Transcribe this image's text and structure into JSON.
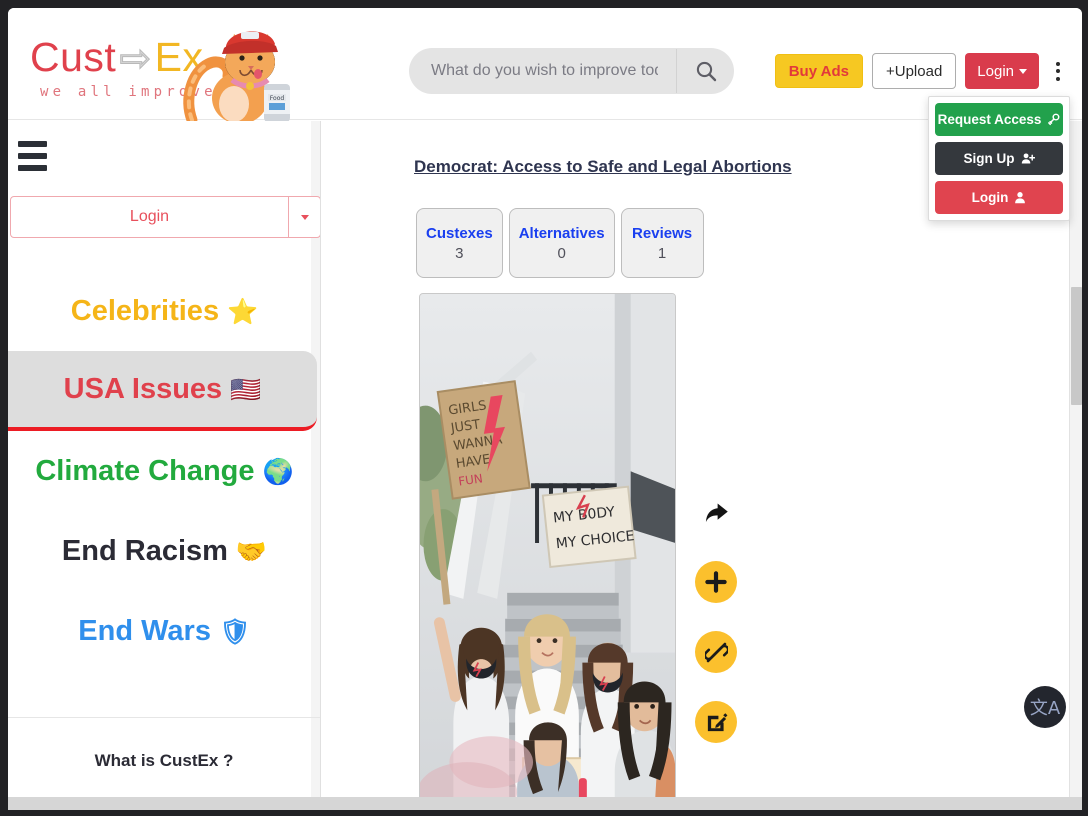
{
  "header": {
    "logo": {
      "word_cust": "Cust",
      "word_arrow": "⇨",
      "word_ex": "Ex",
      "tagline": "we all improve",
      "mascot_icon": "cat-mascot-icon"
    },
    "search": {
      "placeholder": "What do you wish to improve today?",
      "value": "",
      "icon": "search-icon"
    },
    "buy_ads_label": "Buy Ads",
    "upload_label": "+Upload",
    "login_label": "Login",
    "kebab_icon": "vertical-dots-icon"
  },
  "account_dropdown": {
    "items": [
      {
        "label": "Request Access",
        "icon": "key-icon",
        "color": "#22a14c"
      },
      {
        "label": "Sign Up",
        "icon": "user-plus-icon",
        "color": "#34383d"
      },
      {
        "label": "Login",
        "icon": "user-icon",
        "color": "#e0444f"
      }
    ]
  },
  "sidebar": {
    "hamburger_icon": "hamburger-menu-icon",
    "login_label": "Login",
    "login_caret_icon": "caret-down-icon",
    "nav_items": [
      {
        "label": "Celebrities",
        "emoji": "⭐",
        "icon": "star-icon",
        "color": "#f5b518",
        "active": false
      },
      {
        "label": "USA Issues",
        "emoji": "🇺🇸",
        "icon": "usa-flag-icon",
        "color": "#e0414c",
        "active": true
      },
      {
        "label": "Climate Change",
        "emoji": "🌍",
        "icon": "globe-icon",
        "color": "#22aa3e",
        "active": false
      },
      {
        "label": "End Racism",
        "emoji": "🤝",
        "icon": "handshake-icon",
        "color": "#2b2b35",
        "active": false
      },
      {
        "label": "End Wars",
        "emoji": "🛡",
        "icon": "tank-icon",
        "color": "#2f8fec",
        "active": false
      }
    ],
    "what_is_label": "What is CustEx ?"
  },
  "main": {
    "title": "Democrat: Access to Safe and Legal Abortions",
    "stat_tabs": [
      {
        "label": "Custexes",
        "count": "3"
      },
      {
        "label": "Alternatives",
        "count": "0"
      },
      {
        "label": "Reviews",
        "count": "1"
      }
    ],
    "photo": {
      "alt": "Protesters on outdoor stairs holding signs",
      "sign_one": "GIRLS JUST WANNA HAVE FUN",
      "sign_two": "MY BODY MY CHOICE"
    },
    "actions": [
      {
        "name": "share-icon",
        "label": "Share"
      },
      {
        "name": "plus-icon",
        "label": "Add"
      },
      {
        "name": "broken-link-icon",
        "label": "Unlink"
      },
      {
        "name": "edit-pencil-icon",
        "label": "Edit"
      }
    ]
  },
  "translate_fab": {
    "glyph": "文A",
    "icon": "translate-icon"
  },
  "colors": {
    "brand_red": "#e0414c",
    "brand_yellow": "#f2b723",
    "accent_blue": "#1a3ff0",
    "active_bar": "#ec1c24"
  }
}
